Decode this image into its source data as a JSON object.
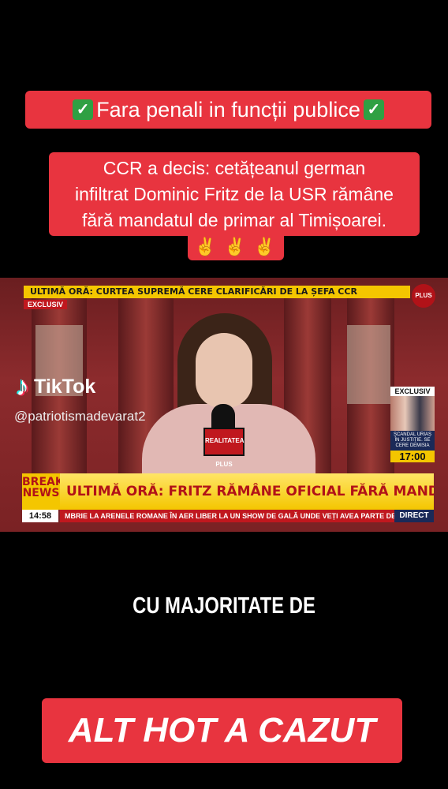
{
  "top_banner": {
    "text": "Fara penali in funcții publice"
  },
  "main_banner": {
    "line1": "CCR a decis: cetățeanul german",
    "line2": "infiltrat Dominic Fritz de la USR rămâne",
    "line3": "fără mandatul de primar al Timișoarei."
  },
  "video": {
    "top_ticker": "ULTIMĂ ORĂ: CURTEA SUPREMĂ CERE CLARIFICĂRI DE LA ȘEFA CCR",
    "exclusiv_tag": "EXCLUSIV",
    "channel_logo": "PLUS",
    "mic_label": "REALITATEA PLUS",
    "side_box": {
      "title": "EXCLUSIV",
      "caption": "SCANDAL URIAȘ ÎN JUSTIȚIE. SE CERE DEMISIA",
      "time": "17:00"
    },
    "breaking_label": "BREAKING NEWS",
    "headline": "ULTIMĂ ORĂ: FRITZ RĂMÂNE OFICIAL FĂRĂ MANDAT, CCR A DECIS",
    "clock": "14:58",
    "crawl": "MBRIE LA ARENELE ROMANE ÎN AER LIBER LA UN SHOW DE GALĂ UNDE VEȚI AVEA PARTE DE C",
    "direct": "DIRECT"
  },
  "tiktok": {
    "brand": "TikTok",
    "handle": "@patriotismadevarat2"
  },
  "caption": "CU MAJORITATE DE",
  "bottom_banner": "ALT HOT A CAZUT",
  "colors": {
    "banner_red": "#e8343f",
    "ticker_yellow": "#f4c600",
    "news_red": "#c0181e"
  },
  "icons": [
    "check-mark-emoji",
    "victory-hand-emoji",
    "tiktok-logo-icon"
  ]
}
